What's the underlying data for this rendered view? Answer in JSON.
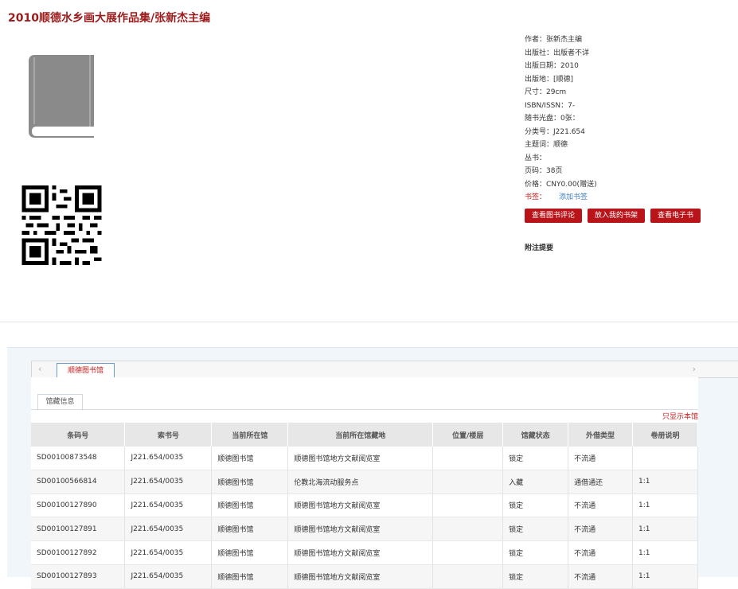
{
  "title": "2010顺德水乡画大展作品集/张新杰主编",
  "meta": [
    "作者：张新杰主编",
    "出版社：出版者不详",
    "出版日期：2010",
    "出版地：[顺德]",
    "尺寸：29cm",
    "ISBN/ISSN：7-",
    "随书光盘：0张：",
    "分类号：J221.654",
    "主题词：顺德",
    "丛书：",
    "页码：38页",
    "价格：CNY0.00(赠送)"
  ],
  "tags": {
    "label": "书签：",
    "link": "添加书签"
  },
  "buttons": {
    "reviews": "查看图书评论",
    "shelf": "放入我的书架",
    "ebook": "查看电子书"
  },
  "annotation": "附注提要",
  "tabbar": {
    "library_tab": "顺德图书馆"
  },
  "holdings": {
    "subtab": "馆藏信息",
    "only_this_library": "只显示本馆",
    "columns": [
      "条码号",
      "索书号",
      "当前所在馆",
      "当前所在馆藏地",
      "位置/楼层",
      "馆藏状态",
      "外借类型",
      "卷册说明"
    ],
    "rows": [
      [
        "SD00100873548",
        "J221.654/0035",
        "顺德图书馆",
        "顺德图书馆地方文献阅览室",
        "",
        "锁定",
        "不流通",
        ""
      ],
      [
        "SD00100566814",
        "J221.654/0035",
        "顺德图书馆",
        "伦教北海流动服务点",
        "",
        "入藏",
        "通借通还",
        "1:1"
      ],
      [
        "SD00100127890",
        "J221.654/0035",
        "顺德图书馆",
        "顺德图书馆地方文献阅览室",
        "",
        "锁定",
        "不流通",
        "1:1"
      ],
      [
        "SD00100127891",
        "J221.654/0035",
        "顺德图书馆",
        "顺德图书馆地方文献阅览室",
        "",
        "锁定",
        "不流通",
        "1:1"
      ],
      [
        "SD00100127892",
        "J221.654/0035",
        "顺德图书馆",
        "顺德图书馆地方文献阅览室",
        "",
        "锁定",
        "不流通",
        "1:1"
      ],
      [
        "SD00100127893",
        "J221.654/0035",
        "顺德图书馆",
        "顺德图书馆地方文献阅览室",
        "",
        "锁定",
        "不流通",
        "1:1"
      ]
    ]
  },
  "colors": {
    "accent": "#b8141a",
    "title": "#9b1b1b",
    "link": "#3f7fbf"
  }
}
